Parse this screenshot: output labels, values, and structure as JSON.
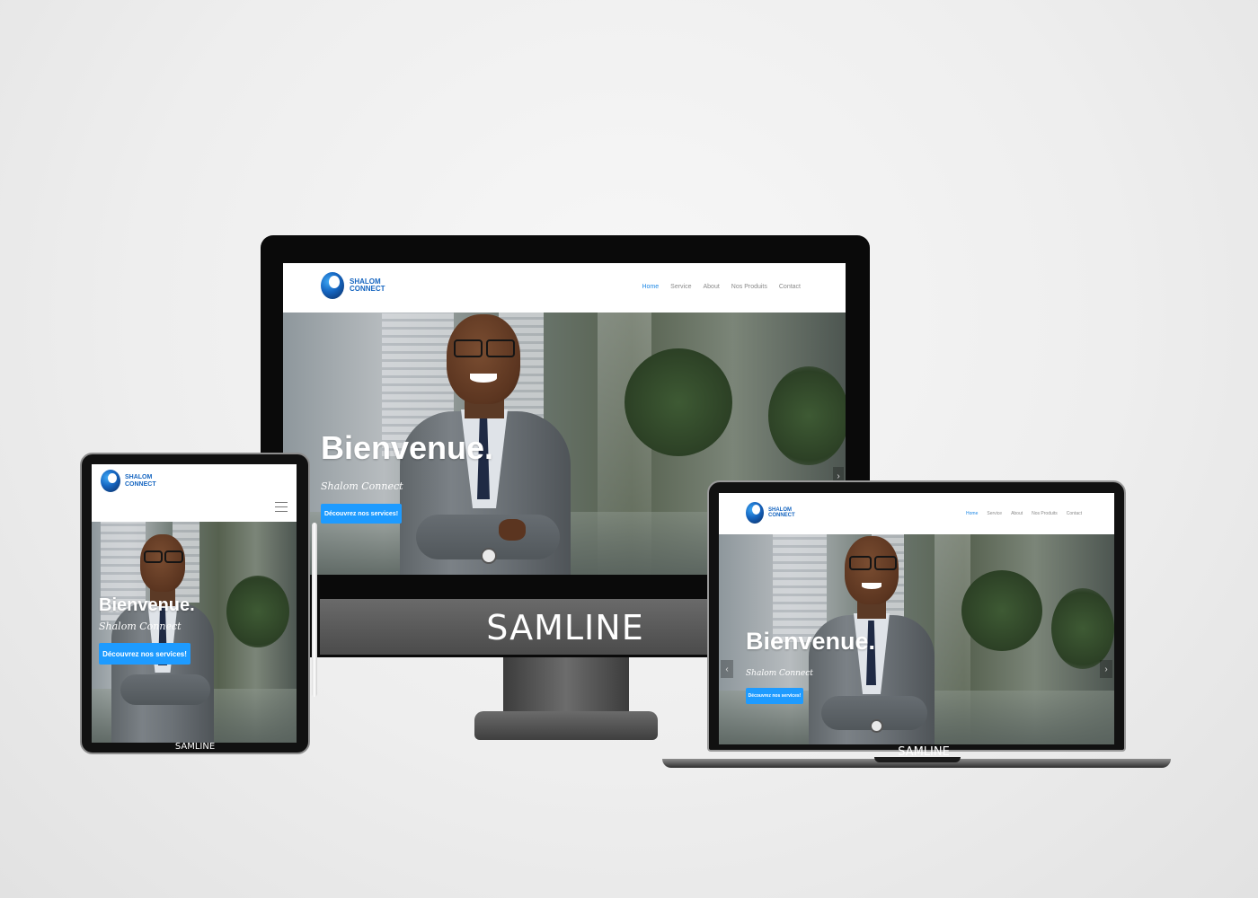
{
  "site": {
    "logo": {
      "line1": "SHALOM",
      "line2": "CONNECT"
    },
    "nav": [
      "Home",
      "Service",
      "About",
      "Nos Produits",
      "Contact"
    ],
    "active_nav": "Home",
    "hero": {
      "title": "Bienvenue.",
      "subtitle": "Shalom Connect",
      "cta": "Découvrez nos services!"
    },
    "carousel_prev": "‹",
    "carousel_next": "›"
  },
  "devices": {
    "monitor_brand": "SAMLINE",
    "laptop_brand": "SAMLINE",
    "tablet_brand": "SAMLINE"
  },
  "colors": {
    "accent": "#1e88e5",
    "button": "#1e9bff",
    "logo": "#1565c0"
  }
}
